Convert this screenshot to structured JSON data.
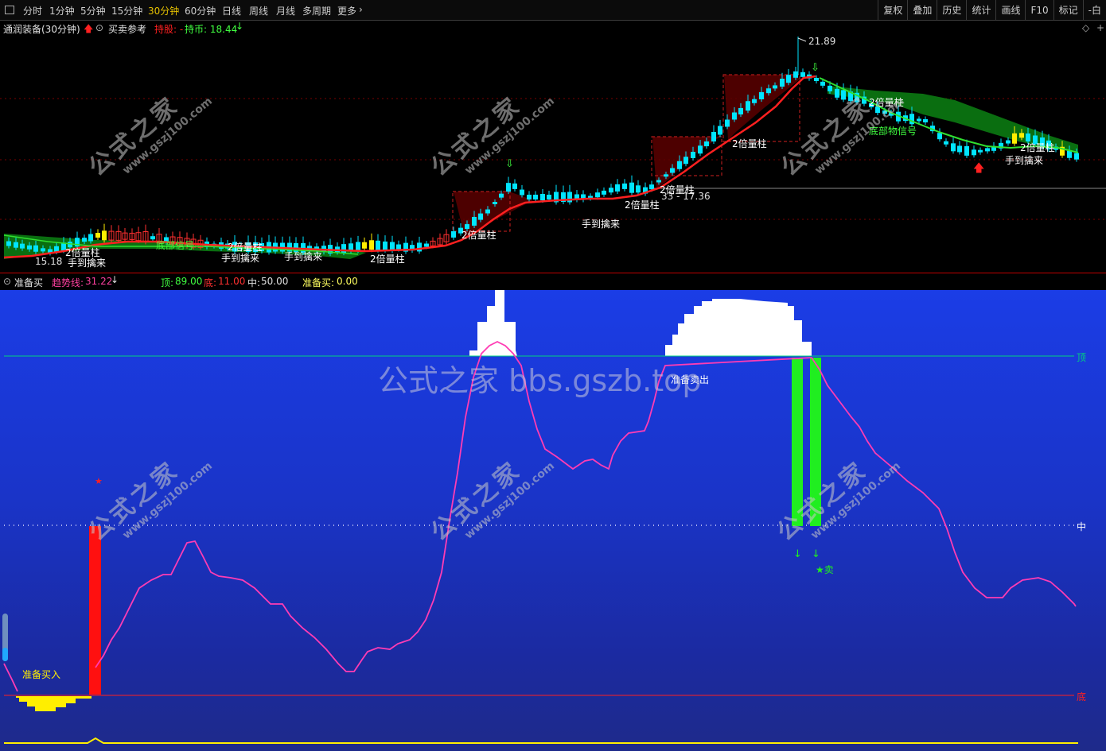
{
  "toolbar": {
    "periods": [
      "分时",
      "1分钟",
      "5分钟",
      "15分钟",
      "30分钟",
      "60分钟",
      "日线",
      "周线",
      "月线",
      "多周期",
      "更多"
    ],
    "active_period": "30分钟",
    "right_buttons": [
      "复权",
      "叠加",
      "历史",
      "统计",
      "画线",
      "F10",
      "标记",
      "-白"
    ]
  },
  "upper": {
    "title": "通润装备(30分钟)",
    "buy_sell_ref": "买卖参考",
    "hold_stock": "持股: -",
    "hold_coin": "持币: 18.44",
    "high_label": "21.89",
    "low_label": "15.18",
    "price_range_label": "33 - 17.36",
    "annotations": {
      "double_volume": "2倍量柱",
      "catch": "手到擒来",
      "bottom_signal": "底部信号",
      "bottom_bottom_signal": "底部物信号",
      "ready_sell_small": "准备卖出"
    }
  },
  "lower": {
    "indicator_name": "准备买",
    "trend_label": "趋势线:",
    "trend_value": "31.22",
    "top_label": "顶:",
    "top_value": "89.00",
    "bottom_label": "底:",
    "bottom_value": "11.00",
    "mid_label": "中:",
    "mid_value": "50.00",
    "ready_buy_label": "准备买:",
    "ready_buy_value": "0.00",
    "right_top": "顶",
    "right_mid": "中",
    "right_bottom": "底",
    "ready_buy_in": "准备买入",
    "ready_sell_out": "准备卖出",
    "sell_mark": "★卖",
    "star": "★"
  },
  "watermarks": {
    "center": "公式之家 bbs.gszb.top",
    "diagonal_big": "公式之家",
    "diagonal_small": "www.gszj100.com"
  },
  "colors": {
    "upper_ma": "#ff2020",
    "candle_up": "#00e5ff",
    "candle_yellow": "#ffff00",
    "band_green": "#0a7a10",
    "band_red": "#7a0000",
    "trend_line": "#ff3cb4",
    "top_line": "#00d080",
    "bottom_line": "#ff2020"
  }
}
